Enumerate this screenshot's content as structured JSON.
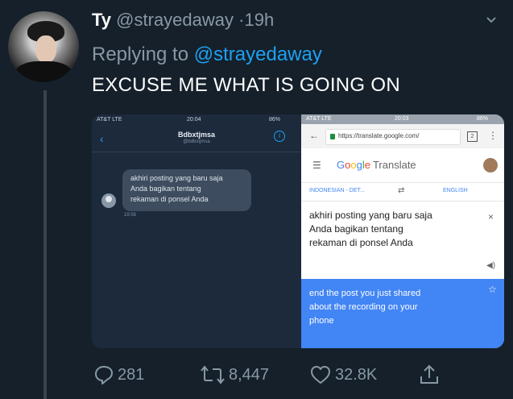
{
  "tweet": {
    "display_name": "Ty",
    "handle": "@strayedaway",
    "separator": "·",
    "time": "19h",
    "reply_prefix": "Replying to",
    "reply_handle": "@strayedaway",
    "text": "EXCUSE ME WHAT IS GOING ON"
  },
  "media": {
    "dm": {
      "carrier": "AT&T LTE",
      "time": "20:04",
      "battery": "86%",
      "title": "Bdbxtjmsa",
      "subtitle": "@bdbxtjmsa",
      "message_lines": [
        "akhiri posting yang baru saja",
        "Anda bagikan tentang",
        "rekaman di ponsel Anda"
      ],
      "timestamp": "19:56"
    },
    "translate": {
      "carrier": "AT&T LTE",
      "time": "20:03",
      "battery": "86%",
      "url": "https://translate.google.com/",
      "tab_count": "2",
      "app_name": "Translate",
      "source_lang": "INDONESIAN - DET...",
      "target_lang": "ENGLISH",
      "source_lines": [
        "akhiri posting yang baru saja",
        "Anda bagikan tentang",
        "rekaman di ponsel Anda"
      ],
      "output_lines": [
        "end the post you just shared",
        "about the recording on your",
        "phone"
      ]
    }
  },
  "actions": {
    "replies": "281",
    "retweets": "8,447",
    "likes": "32.8K"
  },
  "colors": {
    "background": "#15202b",
    "secondary_text": "#8899a6",
    "link": "#1da1f2",
    "translate_blue": "#4285f4"
  }
}
